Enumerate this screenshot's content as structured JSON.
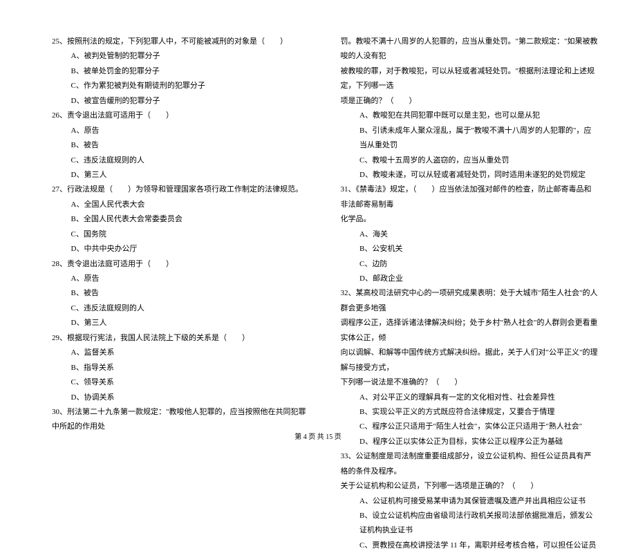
{
  "left": {
    "q25": {
      "stem": "25、按照刑法的规定，下列犯罪人中，不可能被减刑的对象是（　　）",
      "A": "A、被判处管制的犯罪分子",
      "B": "B、被单处罚金的犯罪分子",
      "C": "C、作为累犯被判处有期徒刑的犯罪分子",
      "D": "D、被宣告缓刑的犯罪分子"
    },
    "q26": {
      "stem": "26、责令退出法庭可适用于（　　）",
      "A": "A、原告",
      "B": "B、被告",
      "C": "C、违反法庭规则的人",
      "D": "D、第三人"
    },
    "q27": {
      "stem": "27、行政法规是（　　）为领导和管理国家各项行政工作制定的法律规范。",
      "A": "A、全国人民代表大会",
      "B": "B、全国人民代表大会常委委员会",
      "C": "C、国务院",
      "D": "D、中共中央办公厅"
    },
    "q28": {
      "stem": "28、责令退出法庭可适用于（　　）",
      "A": "A、原告",
      "B": "B、被告",
      "C": "C、违反法庭规则的人",
      "D": "D、第三人"
    },
    "q29": {
      "stem": "29、根据现行宪法，我国人民法院上下级的关系是（　　）",
      "A": "A、监督关系",
      "B": "B、指导关系",
      "C": "C、领导关系",
      "D": "D、协调关系"
    },
    "q30": {
      "stem": "30、刑法第二十九条第一款规定：\"教唆他人犯罪的，应当按照他在共同犯罪中所起的作用处"
    }
  },
  "right": {
    "q30cont": {
      "l1": "罚。教唆不满十八周岁的人犯罪的，应当从重处罚。\"第二款规定：\"如果被教唆的人没有犯",
      "l2": "被教唆的罪，对于教唆犯，可以从轻或者减轻处罚。\"根据刑法理论和上述规定，下列哪一选",
      "l3": "项是正确的？（　　）",
      "A": "A、教唆犯在共同犯罪中既可以是主犯，也可以是从犯",
      "B": "B、引诱未成年人聚众淫乱，属于\"教唆不满十八周岁的人犯罪的\"，应当从重处罚",
      "C": "C、教唆十五周岁的人盗窃的，应当从重处罚",
      "D": "D、教唆未遂，可以从轻或者减轻处罚，同时适用未遂犯的处罚规定"
    },
    "q31": {
      "stem1": "31、《禁毒法》规定，（　　）应当依法加强对邮件的检查，防止邮寄毒品和非法邮寄易制毒",
      "stem2": "化学品。",
      "A": "A、海关",
      "B": "B、公安机关",
      "C": "C、边防",
      "D": "D、邮政企业"
    },
    "q32": {
      "l1": "32、某高校司法研究中心的一项研究成果表明：处于大城市\"陌生人社会\"的人群会更多地强",
      "l2": "调程序公正，选择诉诸法律解决纠纷；处于乡村\"熟人社会\"的人群则会更看重实体公正，倾",
      "l3": "向以调解、和解等中国传统方式解决纠纷。据此，关于人们对\"公平正义\"的理解与接受方式，",
      "l4": "下列哪一说法是不准确的？（　　）",
      "A": "A、对公平正义的理解具有一定的文化相对性、社会差异性",
      "B": "B、实现公平正义的方式既应符合法律规定，又要合于情理",
      "C": "C、程序公正只适用于\"陌生人社会\"，实体公正只适用于\"熟人社会\"",
      "D": "D、程序公正以实体公正为目标，实体公正以程序公正为基础"
    },
    "q33": {
      "l1": "33、公证制度是司法制度重要组成部分，设立公证机构、担任公证员具有严格的条件及程序。",
      "l2": "关于公证机构和公证员，下列哪一选项是正确的？（　　）",
      "A": "A、公证机构可接受易某申请为其保管遗嘱及遗产并出具相应公证书",
      "B": "B、设立公证机构应由省级司法行政机关报司法部依据批准后，颁发公证机构执业证书",
      "C": "C、贾教授在高校讲授法学 11 年，离职并经考核合格，可以担任公证员"
    }
  },
  "footer": "第 4 页 共 15 页"
}
